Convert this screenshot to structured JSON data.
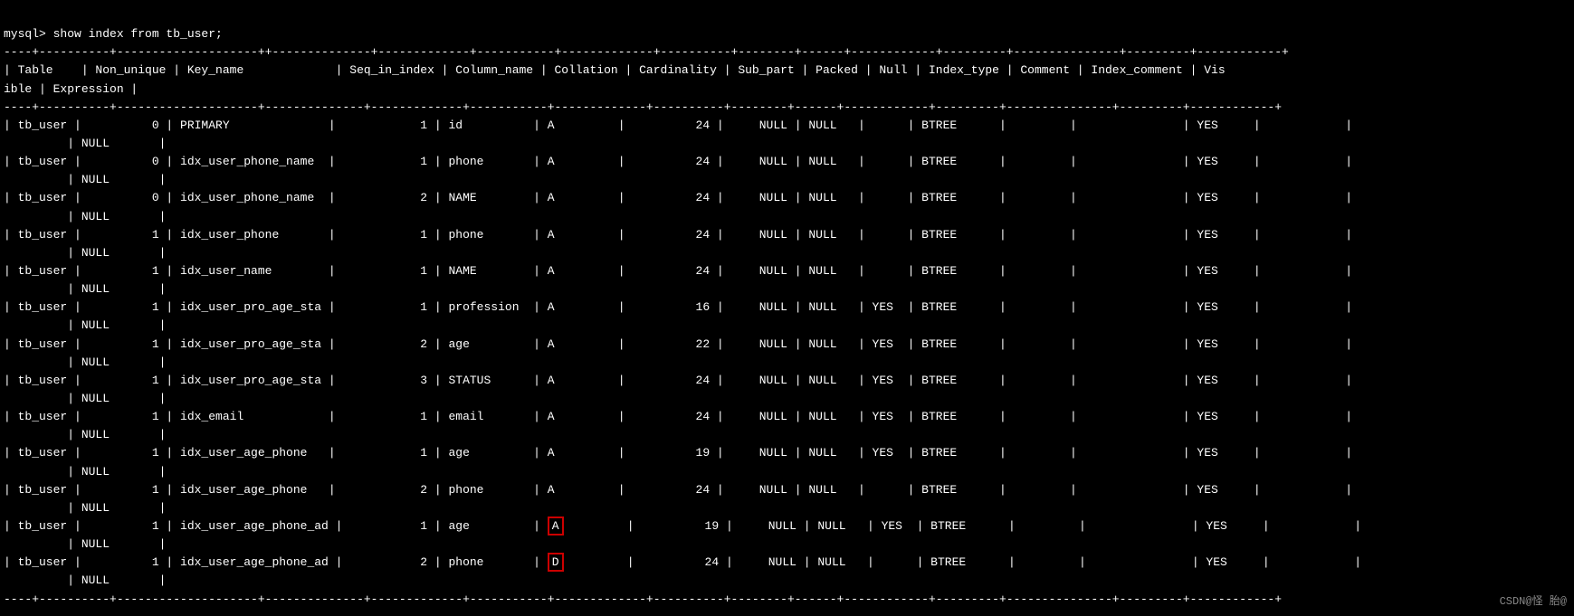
{
  "terminal": {
    "command": "mysql> show index from tb_user;",
    "separator1": "----+----------+-----",
    "header": "| Table    | Non_unique | Key_name             | Seq_in_index | Column_name | Collation | Cardinality | Sub_part | Packed | Null | Index_type | Comment | Index_comment | Visible | Expression |",
    "rows": [
      {
        "table": "tb_user",
        "non_unique": "0",
        "key_name": "PRIMARY",
        "seq": "1",
        "col": "id",
        "collation": "A",
        "cardinality": "24",
        "sub_part": "NULL",
        "packed": "NULL",
        "null_val": "",
        "index_type": "BTREE",
        "comment": "",
        "index_comment": "",
        "visible": "YES",
        "highlight_col": false,
        "highlight_collation": false
      },
      {
        "table": "tb_user",
        "non_unique": "0",
        "key_name": "idx_user_phone_name",
        "seq": "1",
        "col": "phone",
        "collation": "A",
        "cardinality": "24",
        "sub_part": "NULL",
        "packed": "NULL",
        "null_val": "",
        "index_type": "BTREE",
        "comment": "",
        "index_comment": "",
        "visible": "YES",
        "highlight_col": false,
        "highlight_collation": false
      },
      {
        "table": "tb_user",
        "non_unique": "0",
        "key_name": "idx_user_phone_name",
        "seq": "2",
        "col": "NAME",
        "collation": "A",
        "cardinality": "24",
        "sub_part": "NULL",
        "packed": "NULL",
        "null_val": "",
        "index_type": "BTREE",
        "comment": "",
        "index_comment": "",
        "visible": "YES",
        "highlight_col": false,
        "highlight_collation": false
      },
      {
        "table": "tb_user",
        "non_unique": "1",
        "key_name": "idx_user_phone",
        "seq": "1",
        "col": "phone",
        "collation": "A",
        "cardinality": "24",
        "sub_part": "NULL",
        "packed": "NULL",
        "null_val": "",
        "index_type": "BTREE",
        "comment": "",
        "index_comment": "",
        "visible": "YES",
        "highlight_col": false,
        "highlight_collation": false
      },
      {
        "table": "tb_user",
        "non_unique": "1",
        "key_name": "idx_user_name",
        "seq": "1",
        "col": "NAME",
        "collation": "A",
        "cardinality": "24",
        "sub_part": "NULL",
        "packed": "NULL",
        "null_val": "",
        "index_type": "BTREE",
        "comment": "",
        "index_comment": "",
        "visible": "YES",
        "highlight_col": false,
        "highlight_collation": false
      },
      {
        "table": "tb_user",
        "non_unique": "1",
        "key_name": "idx_user_pro_age_sta",
        "seq": "1",
        "col": "profession",
        "collation": "A",
        "cardinality": "16",
        "sub_part": "NULL",
        "packed": "NULL",
        "null_val": "YES",
        "index_type": "BTREE",
        "comment": "",
        "index_comment": "",
        "visible": "YES",
        "highlight_col": false,
        "highlight_collation": false
      },
      {
        "table": "tb_user",
        "non_unique": "1",
        "key_name": "idx_user_pro_age_sta",
        "seq": "2",
        "col": "age",
        "collation": "A",
        "cardinality": "22",
        "sub_part": "NULL",
        "packed": "NULL",
        "null_val": "YES",
        "index_type": "BTREE",
        "comment": "",
        "index_comment": "",
        "visible": "YES",
        "highlight_col": false,
        "highlight_collation": false
      },
      {
        "table": "tb_user",
        "non_unique": "1",
        "key_name": "idx_user_pro_age_sta",
        "seq": "3",
        "col": "STATUS",
        "collation": "A",
        "cardinality": "24",
        "sub_part": "NULL",
        "packed": "NULL",
        "null_val": "YES",
        "index_type": "BTREE",
        "comment": "",
        "index_comment": "",
        "visible": "YES",
        "highlight_col": false,
        "highlight_collation": false
      },
      {
        "table": "tb_user",
        "non_unique": "1",
        "key_name": "idx_email",
        "seq": "1",
        "col": "email",
        "collation": "A",
        "cardinality": "24",
        "sub_part": "NULL",
        "packed": "NULL",
        "null_val": "YES",
        "index_type": "BTREE",
        "comment": "",
        "index_comment": "",
        "visible": "YES",
        "highlight_col": false,
        "highlight_collation": false
      },
      {
        "table": "tb_user",
        "non_unique": "1",
        "key_name": "idx_user_age_phone",
        "seq": "1",
        "col": "age",
        "collation": "A",
        "cardinality": "19",
        "sub_part": "NULL",
        "packed": "NULL",
        "null_val": "YES",
        "index_type": "BTREE",
        "comment": "",
        "index_comment": "",
        "visible": "YES",
        "highlight_col": false,
        "highlight_collation": false
      },
      {
        "table": "tb_user",
        "non_unique": "1",
        "key_name": "idx_user_age_phone",
        "seq": "2",
        "col": "phone",
        "collation": "A",
        "cardinality": "24",
        "sub_part": "NULL",
        "packed": "NULL",
        "null_val": "",
        "index_type": "BTREE",
        "comment": "",
        "index_comment": "",
        "visible": "YES",
        "highlight_col": false,
        "highlight_collation": false
      },
      {
        "table": "tb_user",
        "non_unique": "1",
        "key_name": "idx_user_age_phone_ad",
        "seq": "1",
        "col": "age",
        "collation": "A",
        "cardinality": "19",
        "sub_part": "NULL",
        "packed": "NULL",
        "null_val": "YES",
        "index_type": "BTREE",
        "comment": "",
        "index_comment": "",
        "visible": "YES",
        "highlight_col": false,
        "highlight_collation": true
      },
      {
        "table": "tb_user",
        "non_unique": "1",
        "key_name": "idx_user_age_phone_ad",
        "seq": "2",
        "col": "phone",
        "collation": "D",
        "cardinality": "24",
        "sub_part": "NULL",
        "packed": "NULL",
        "null_val": "",
        "index_type": "BTREE",
        "comment": "",
        "index_comment": "",
        "visible": "YES",
        "highlight_col": true,
        "highlight_collation": true
      }
    ],
    "watermark": "CSDN@怪 胎@"
  }
}
